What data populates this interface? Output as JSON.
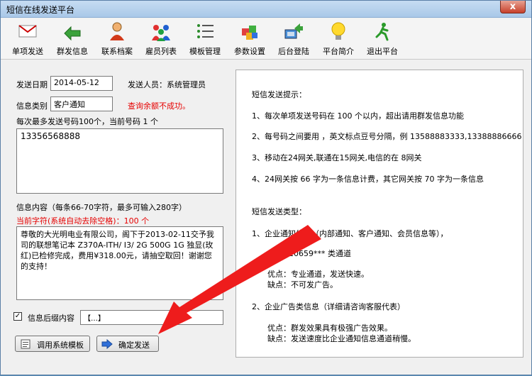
{
  "window": {
    "title": "短信在线发送平台",
    "close_label": "x"
  },
  "toolbar": [
    {
      "label": "单项发送",
      "icon": "envelope-icon"
    },
    {
      "label": "群发信息",
      "icon": "back-arrow-icon"
    },
    {
      "label": "联系档案",
      "icon": "person-icon"
    },
    {
      "label": "雇员列表",
      "icon": "people-icon"
    },
    {
      "label": "模板管理",
      "icon": "list-icon"
    },
    {
      "label": "参数设置",
      "icon": "blocks-icon"
    },
    {
      "label": "后台登陆",
      "icon": "login-icon"
    },
    {
      "label": "平台简介",
      "icon": "lightbulb-icon"
    },
    {
      "label": "退出平台",
      "icon": "exit-icon"
    }
  ],
  "form": {
    "date_label": "发送日期",
    "date_value": "2014-05-12",
    "sender_label": "发送人员：系统管理员",
    "category_label": "信息类别",
    "category_value": "客户通知",
    "balance_error": "查询余额不成功。",
    "number_hint": "每次最多发送号码100个，当前号码 1 个",
    "numbers_value": "13356568888",
    "content_hint": "信息内容（每条66-70字符，最多可输入280字）",
    "char_count": "当前字符(系统自动去除空格)：100 个",
    "content_value": "尊敬的大光明电业有限公司，阁下于2013-02-11交予我司的联想笔记本 Z370A-ITH/ I3/ 2G 500G 1G 独显(玫红)已检修完成，费用¥318.00元，请抽空取回！谢谢您的支持！",
    "suffix_checked": true,
    "suffix_label": "信息后缀内容",
    "suffix_value": "【…】",
    "template_button": "调用系统模板",
    "send_button": "确定发送"
  },
  "tips": {
    "heading": "短信发送提示：",
    "items": [
      "1、每次单项发送号码在 100 个以内，超出请用群发信息功能",
      "2、每号码之间要用 ，英文标点豆号分隔，例 13588883333,13388886666",
      "3、移动在24网关,联通在15网关,电信的在 8网关",
      "4、24网关按 66 字为一条信息计费，其它网关按 70 字为一条信息"
    ],
    "types_heading": "短信发送类型：",
    "type1_title": "1、企业通知信息（内部通知、客户通知、会员信息等），",
    "type1_channel": "10659*** 类通道",
    "type1_pro": "优点：专业通道，发送快速。",
    "type1_con": "缺点：不可发广告。",
    "type2_title": "2、企业广告类信息（详细请咨询客服代表）",
    "type2_pro": "优点：群发效果具有极强广告效果。",
    "type2_con": "缺点：发送速度比企业通知信息通道稍慢。"
  },
  "colors": {
    "accent_red": "#e60000",
    "arrow_red": "#ee1c1c"
  }
}
